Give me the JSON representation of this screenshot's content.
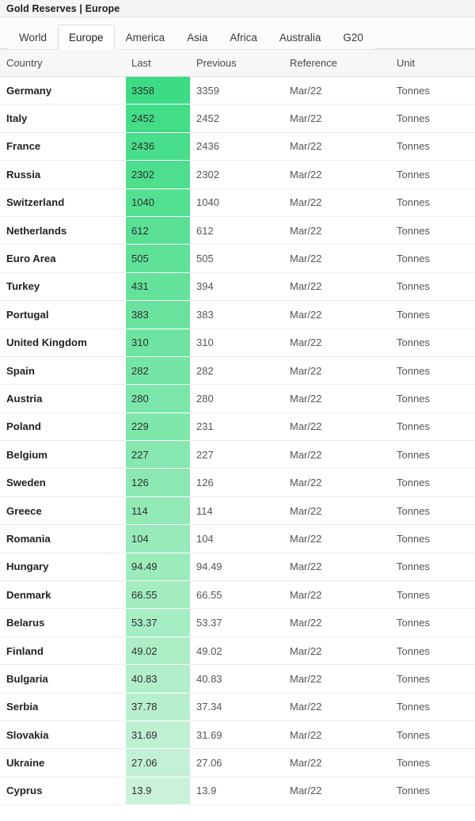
{
  "window": {
    "title": "Gold Reserves | Europe"
  },
  "tabs": {
    "active": "Europe",
    "items": [
      {
        "label": "World",
        "active": false
      },
      {
        "label": "Europe",
        "active": true
      },
      {
        "label": "America",
        "active": false
      },
      {
        "label": "Asia",
        "active": false
      },
      {
        "label": "Africa",
        "active": false
      },
      {
        "label": "Australia",
        "active": false
      },
      {
        "label": "G20",
        "active": false
      }
    ]
  },
  "colors": {
    "heat_top": "#3ddc84",
    "heat_bottom": "#c9f2d8",
    "title_bar_bg": "#f5f5f5",
    "header_bg": "#f7f7f7",
    "row_border": "#ececec",
    "text_primary": "#222222",
    "text_secondary": "#555555"
  },
  "table": {
    "columns": [
      {
        "key": "country",
        "label": "Country"
      },
      {
        "key": "last",
        "label": "Last"
      },
      {
        "key": "previous",
        "label": "Previous"
      },
      {
        "key": "reference",
        "label": "Reference"
      },
      {
        "key": "unit",
        "label": "Unit"
      }
    ],
    "rows": [
      {
        "country": "Germany",
        "last": "3358",
        "previous": "3359",
        "reference": "Mar/22",
        "unit": "Tonnes"
      },
      {
        "country": "Italy",
        "last": "2452",
        "previous": "2452",
        "reference": "Mar/22",
        "unit": "Tonnes"
      },
      {
        "country": "France",
        "last": "2436",
        "previous": "2436",
        "reference": "Mar/22",
        "unit": "Tonnes"
      },
      {
        "country": "Russia",
        "last": "2302",
        "previous": "2302",
        "reference": "Mar/22",
        "unit": "Tonnes"
      },
      {
        "country": "Switzerland",
        "last": "1040",
        "previous": "1040",
        "reference": "Mar/22",
        "unit": "Tonnes"
      },
      {
        "country": "Netherlands",
        "last": "612",
        "previous": "612",
        "reference": "Mar/22",
        "unit": "Tonnes"
      },
      {
        "country": "Euro Area",
        "last": "505",
        "previous": "505",
        "reference": "Mar/22",
        "unit": "Tonnes"
      },
      {
        "country": "Turkey",
        "last": "431",
        "previous": "394",
        "reference": "Mar/22",
        "unit": "Tonnes"
      },
      {
        "country": "Portugal",
        "last": "383",
        "previous": "383",
        "reference": "Mar/22",
        "unit": "Tonnes"
      },
      {
        "country": "United Kingdom",
        "last": "310",
        "previous": "310",
        "reference": "Mar/22",
        "unit": "Tonnes"
      },
      {
        "country": "Spain",
        "last": "282",
        "previous": "282",
        "reference": "Mar/22",
        "unit": "Tonnes"
      },
      {
        "country": "Austria",
        "last": "280",
        "previous": "280",
        "reference": "Mar/22",
        "unit": "Tonnes"
      },
      {
        "country": "Poland",
        "last": "229",
        "previous": "231",
        "reference": "Mar/22",
        "unit": "Tonnes"
      },
      {
        "country": "Belgium",
        "last": "227",
        "previous": "227",
        "reference": "Mar/22",
        "unit": "Tonnes"
      },
      {
        "country": "Sweden",
        "last": "126",
        "previous": "126",
        "reference": "Mar/22",
        "unit": "Tonnes"
      },
      {
        "country": "Greece",
        "last": "114",
        "previous": "114",
        "reference": "Mar/22",
        "unit": "Tonnes"
      },
      {
        "country": "Romania",
        "last": "104",
        "previous": "104",
        "reference": "Mar/22",
        "unit": "Tonnes"
      },
      {
        "country": "Hungary",
        "last": "94.49",
        "previous": "94.49",
        "reference": "Mar/22",
        "unit": "Tonnes"
      },
      {
        "country": "Denmark",
        "last": "66.55",
        "previous": "66.55",
        "reference": "Mar/22",
        "unit": "Tonnes"
      },
      {
        "country": "Belarus",
        "last": "53.37",
        "previous": "53.37",
        "reference": "Mar/22",
        "unit": "Tonnes"
      },
      {
        "country": "Finland",
        "last": "49.02",
        "previous": "49.02",
        "reference": "Mar/22",
        "unit": "Tonnes"
      },
      {
        "country": "Bulgaria",
        "last": "40.83",
        "previous": "40.83",
        "reference": "Mar/22",
        "unit": "Tonnes"
      },
      {
        "country": "Serbia",
        "last": "37.78",
        "previous": "37.34",
        "reference": "Mar/22",
        "unit": "Tonnes"
      },
      {
        "country": "Slovakia",
        "last": "31.69",
        "previous": "31.69",
        "reference": "Mar/22",
        "unit": "Tonnes"
      },
      {
        "country": "Ukraine",
        "last": "27.06",
        "previous": "27.06",
        "reference": "Mar/22",
        "unit": "Tonnes"
      },
      {
        "country": "Cyprus",
        "last": "13.9",
        "previous": "13.9",
        "reference": "Mar/22",
        "unit": "Tonnes"
      }
    ]
  }
}
